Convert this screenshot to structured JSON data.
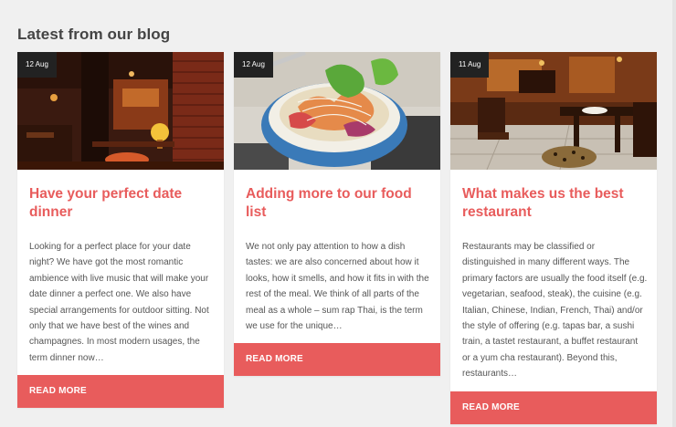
{
  "section": {
    "title": "Latest from our blog"
  },
  "posts": [
    {
      "date": "12 Aug",
      "title": "Have your perfect date dinner",
      "excerpt": "Looking for a perfect place for your date night? We have got the most romantic ambience with live music that will make your date dinner a perfect one. We also have special arrangements for outdoor sitting. Not only that we have best of the wines and champagnes. In most modern usages, the term dinner now…",
      "read_more": "READ MORE"
    },
    {
      "date": "12 Aug",
      "title": "Adding more to our food list",
      "excerpt": "We not only pay attention to how a dish tastes: we are also concerned about how it looks, how it smells, and how it fits in with the rest of the meal. We think of all parts of the meal as a whole – sum rap Thai, is the term we use for the unique…",
      "read_more": "READ MORE"
    },
    {
      "date": "11 Aug",
      "title": "What makes us the best restaurant",
      "excerpt": "Restaurants may be classified or distinguished in many different ways. The primary factors are usually the food itself (e.g. vegetarian, seafood, steak), the cuisine (e.g. Italian, Chinese, Indian, French, Thai) and/or the style of offering (e.g. tapas bar, a sushi train, a tastet restaurant, a buffet restaurant or a yum cha restaurant). Beyond this, restaurants…",
      "read_more": "READ MORE"
    }
  ],
  "colors": {
    "accent": "#e85c5c",
    "badge": "#222222",
    "heading": "#444444"
  }
}
